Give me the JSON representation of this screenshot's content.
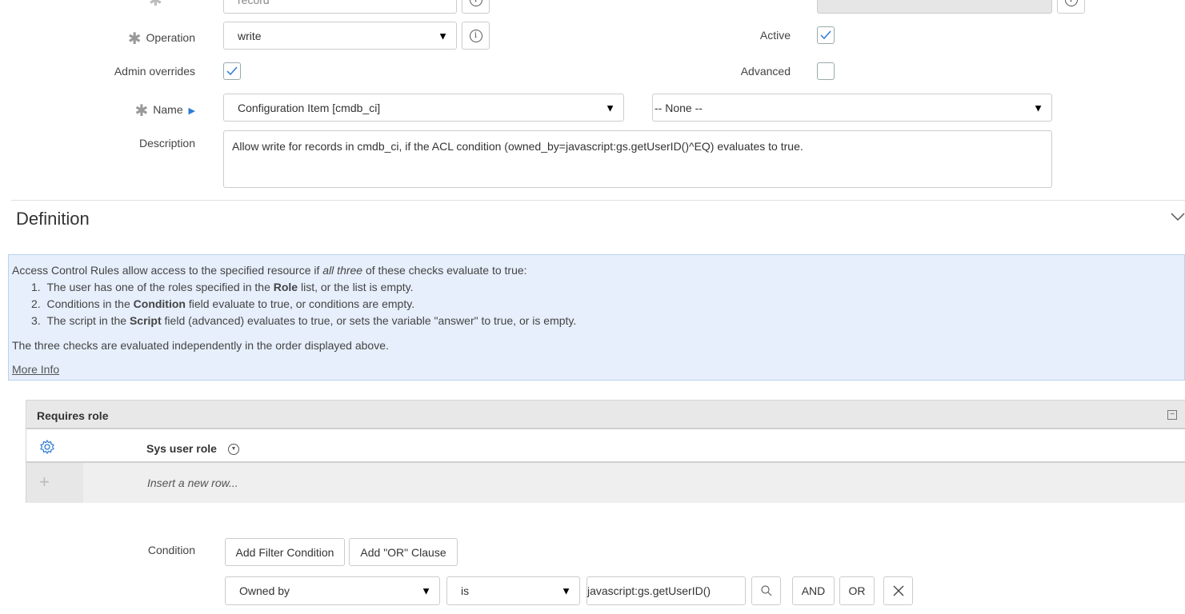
{
  "form": {
    "type_value": "record",
    "operation_label": "Operation",
    "operation_value": "write",
    "active_label": "Active",
    "active_checked": true,
    "admin_overrides_label": "Admin overrides",
    "admin_overrides_checked": true,
    "advanced_label": "Advanced",
    "advanced_checked": false,
    "name_label": "Name",
    "name_table_value": "Configuration Item [cmdb_ci]",
    "name_field_value": "-- None --",
    "description_label": "Description",
    "description_value": "Allow write for records in cmdb_ci, if the ACL condition (owned_by=javascript:gs.getUserID()^EQ) evaluates to true."
  },
  "definition": {
    "title": "Definition",
    "info": {
      "intro_before": "Access Control Rules allow access to the specified resource if ",
      "intro_em": "all three",
      "intro_after": " of these checks evaluate to true:",
      "items": [
        {
          "num": "1.",
          "before": "The user has one of the roles specified in the ",
          "bold": "Role",
          "after": " list, or the list is empty."
        },
        {
          "num": "2.",
          "before": "Conditions in the ",
          "bold": "Condition",
          "after": " field evaluate to true, or conditions are empty."
        },
        {
          "num": "3.",
          "before": "The script in the ",
          "bold": "Script",
          "after": " field (advanced) evaluates to true, or sets the variable \"answer\" to true, or is empty."
        }
      ],
      "footer": "The three checks are evaluated independently in the order displayed above.",
      "more_info": "More Info"
    }
  },
  "requires_role": {
    "title": "Requires role",
    "column_header": "Sys user role",
    "insert_row": "Insert a new row..."
  },
  "condition": {
    "label": "Condition",
    "add_filter_label": "Add Filter Condition",
    "add_or_label": "Add \"OR\" Clause",
    "field_value": "Owned by",
    "operator_value": "is",
    "value": "javascript:gs.getUserID()",
    "and_label": "AND",
    "or_label": "OR"
  }
}
